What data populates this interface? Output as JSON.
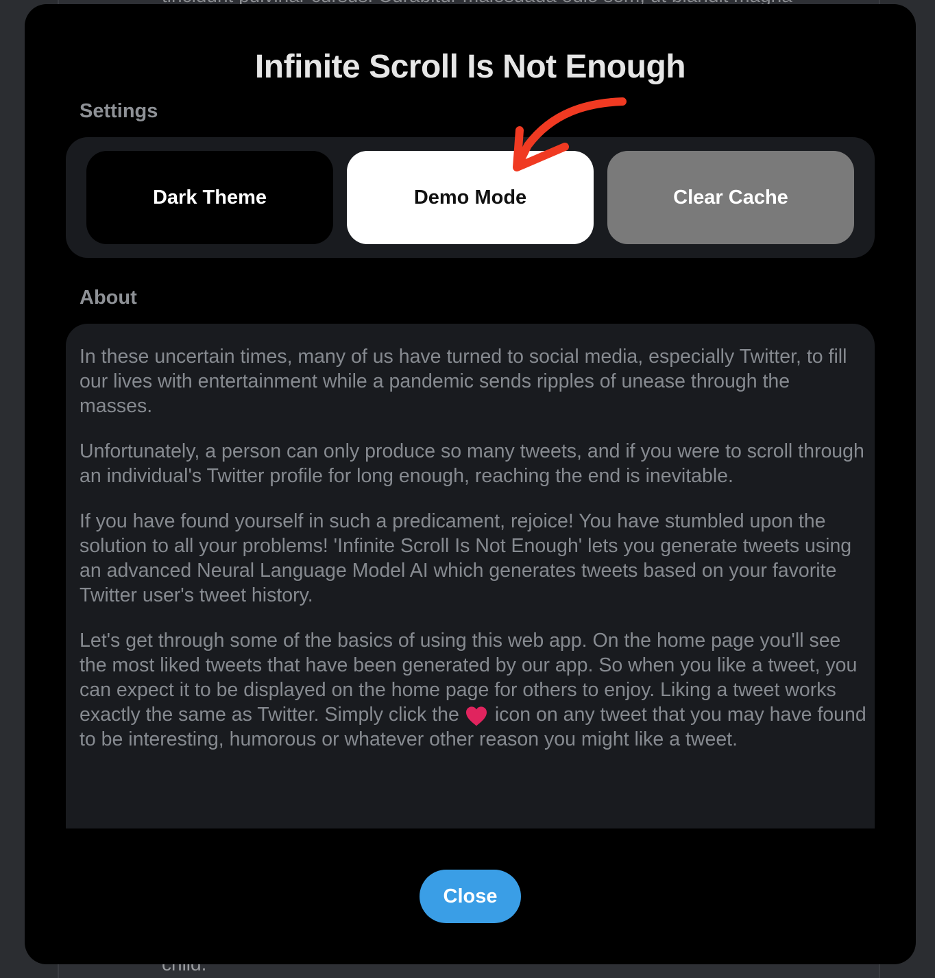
{
  "background": {
    "text_top": "tincidunt pulvinar cursus. Curabitur malesuada odio sem, ut blandit magna",
    "text_bottom": "child."
  },
  "modal": {
    "title": "Infinite Scroll Is Not Enough",
    "settings_label": "Settings",
    "settings_buttons": [
      {
        "label": "Dark Theme",
        "state": "off"
      },
      {
        "label": "Demo Mode",
        "state": "active"
      },
      {
        "label": "Clear Cache",
        "state": "disabled"
      }
    ],
    "about_label": "About",
    "about_paragraphs": [
      "In these uncertain times, many of us have turned to social media, especially Twitter, to fill our lives with entertainment while a pandemic sends ripples of unease through the masses.",
      "Unfortunately, a person can only produce so many tweets, and if you were to scroll through an individual's Twitter profile for long enough, reaching the end is inevitable.",
      "If you have found yourself in such a predicament, rejoice! You have stumbled upon the solution to all your problems! 'Infinite Scroll Is Not Enough' lets you generate tweets using an advanced Neural Language Model AI which generates tweets based on your favorite Twitter user's tweet history."
    ],
    "about_paragraph_4": {
      "before_icon": "Let's get through some of the basics of using this web app. On the home page you'll see the most liked tweets that have been generated by our app. So when you like a tweet, you can expect it to be displayed on the home page for others to enjoy. Liking a tweet works exactly the same as Twitter. Simply click the",
      "icon": "heart-icon",
      "after_icon": "icon on any tweet that you may have found to be interesting, humorous or whatever other reason you might like a tweet."
    },
    "close_label": "Close"
  },
  "colors": {
    "close_button": "#3a9ee6",
    "heart": "#e0245e",
    "annotation_arrow": "#f03a22"
  }
}
